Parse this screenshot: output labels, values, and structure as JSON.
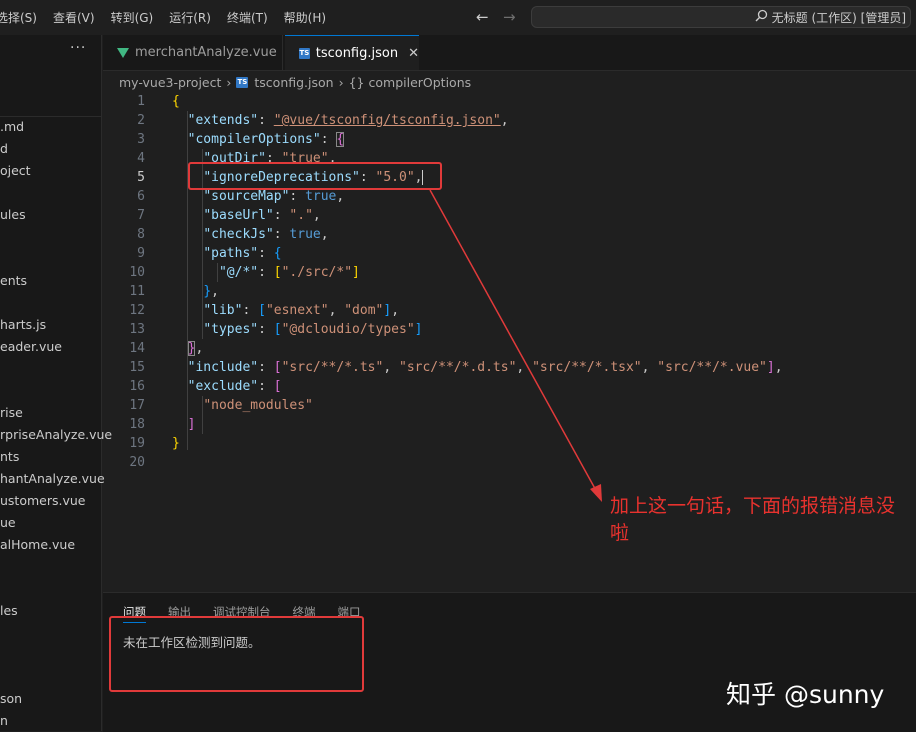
{
  "menu": [
    "选择(S)",
    "查看(V)",
    "转到(G)",
    "运行(R)",
    "终端(T)",
    "帮助(H)"
  ],
  "nav": {
    "back": "←",
    "forward": "→"
  },
  "command_center": {
    "icon": "search-icon",
    "text": "无标题 (工作区) [管理员]"
  },
  "sidebar": {
    "more": "···",
    "items": [
      ".md",
      "d",
      "oject",
      "ules",
      "ents",
      "harts.js",
      "eader.vue",
      "rise",
      "rpriseAnalyze.vue",
      "nts",
      "hantAnalyze.vue",
      "ustomers.vue",
      "ue",
      "alHome.vue",
      "les",
      "son",
      "n"
    ]
  },
  "tabs": [
    {
      "label": "merchantAnalyze.vue",
      "icon": "vue-icon",
      "active": false
    },
    {
      "label": "tsconfig.json",
      "icon": "ts-icon",
      "active": true,
      "close": "✕"
    }
  ],
  "ts_badge": "TS",
  "breadcrumb": {
    "project": "my-vue3-project",
    "file": "tsconfig.json",
    "symbol_icon": "{}",
    "symbol": "compilerOptions"
  },
  "editor": {
    "active_line": 5,
    "line_numbers": [
      "1",
      "2",
      "3",
      "4",
      "5",
      "6",
      "7",
      "8",
      "9",
      "10",
      "11",
      "12",
      "13",
      "14",
      "15",
      "16",
      "17",
      "18",
      "19",
      "20"
    ]
  },
  "panel": {
    "tabs": [
      "问题",
      "输出",
      "调试控制台",
      "终端",
      "端口"
    ],
    "message": "未在工作区检测到问题。"
  },
  "annotation": {
    "text": "加上这一句话，下面的报错消息没啦",
    "color": "#e8322e"
  },
  "watermark": "知乎 @sunny",
  "colors": {
    "key": "#9cdcfe",
    "string": "#ce9178",
    "boolean": "#569cd6",
    "accent": "#0078d4"
  }
}
